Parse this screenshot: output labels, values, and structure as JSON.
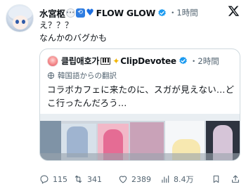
{
  "tweet": {
    "author_name": "水宮枢",
    "author_name_suffix": "FLOW GLOW",
    "time": "・1時間",
    "lines": [
      "え？？？",
      "なんかのバグかも"
    ]
  },
  "quote": {
    "author_name": "클립애호가",
    "author_handle": "ClipDevotee",
    "time": "・2時間",
    "translation_label": "韓国語からの翻訳",
    "lines": [
      "コラボカフェに来たのに、スガが見えない…ど",
      "こ行ったんだろう…"
    ]
  },
  "actions": {
    "replies": "115",
    "reposts": "341",
    "likes": "2389",
    "views": "8.4万"
  },
  "colors": {
    "verified": "#1d9bf0",
    "muted_text": "#536471",
    "border": "#cfd9de"
  },
  "icons": {
    "logo": "x-logo-icon",
    "verified": "verified-badge-icon",
    "translate": "globe-icon",
    "reply": "reply-icon",
    "repost": "repost-icon",
    "like": "heart-icon",
    "views": "views-chart-icon",
    "bookmark": "bookmark-icon",
    "share": "share-icon"
  }
}
